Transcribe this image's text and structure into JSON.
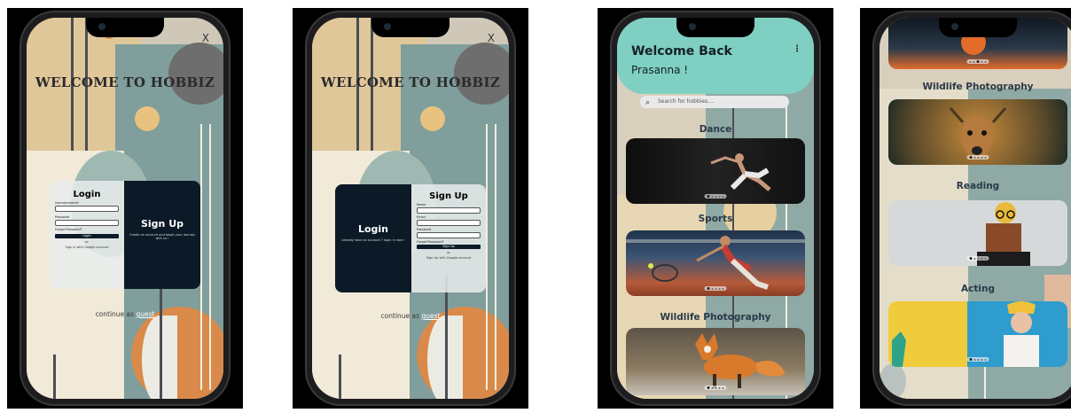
{
  "login_screen": {
    "title": "WELCOME TO HOBBIZ",
    "close": "X",
    "login": {
      "title": "Login",
      "username_label": "Username/mail",
      "password_label": "Password",
      "forgot": "Forgot Password?",
      "login_button": "Login",
      "or": "or",
      "google": "Sign in with Google account"
    },
    "signup_panel": {
      "title": "Sign Up",
      "description": "Create an account and begin your journey with us !"
    },
    "guest_prefix": "continue as",
    "guest_link": "guest"
  },
  "signup_screen": {
    "title": "WELCOME TO HOBBIZ",
    "close": "X",
    "login_panel": {
      "title": "Login",
      "description": "Already have an account ? login in now !"
    },
    "signup": {
      "title": "Sign Up",
      "name_label": "Name",
      "email_label": "Email",
      "password_label": "Password",
      "forgot": "Forgot Password?",
      "signup_button": "Sign Up",
      "or": "or",
      "google": "Sign Up with Google account"
    },
    "guest_prefix": "continue as",
    "guest_link": "guest"
  },
  "home_screen": {
    "welcome": "Welcome Back",
    "name": "Prasanna !",
    "search_placeholder": "Search for hobbies....",
    "categories": [
      "Dance",
      "Sports",
      "Wildlife Photography"
    ]
  },
  "scroll_screen": {
    "categories": [
      "Wildlife Photography",
      "Reading",
      "Acting"
    ]
  },
  "colors": {
    "teal": "#7fd0c2",
    "navy": "#0b1a26",
    "orange": "#d98a4a",
    "sage": "#8fa9a5"
  },
  "icons": [
    "close-icon",
    "search-icon",
    "kebab-menu-icon",
    "carousel-dots"
  ]
}
